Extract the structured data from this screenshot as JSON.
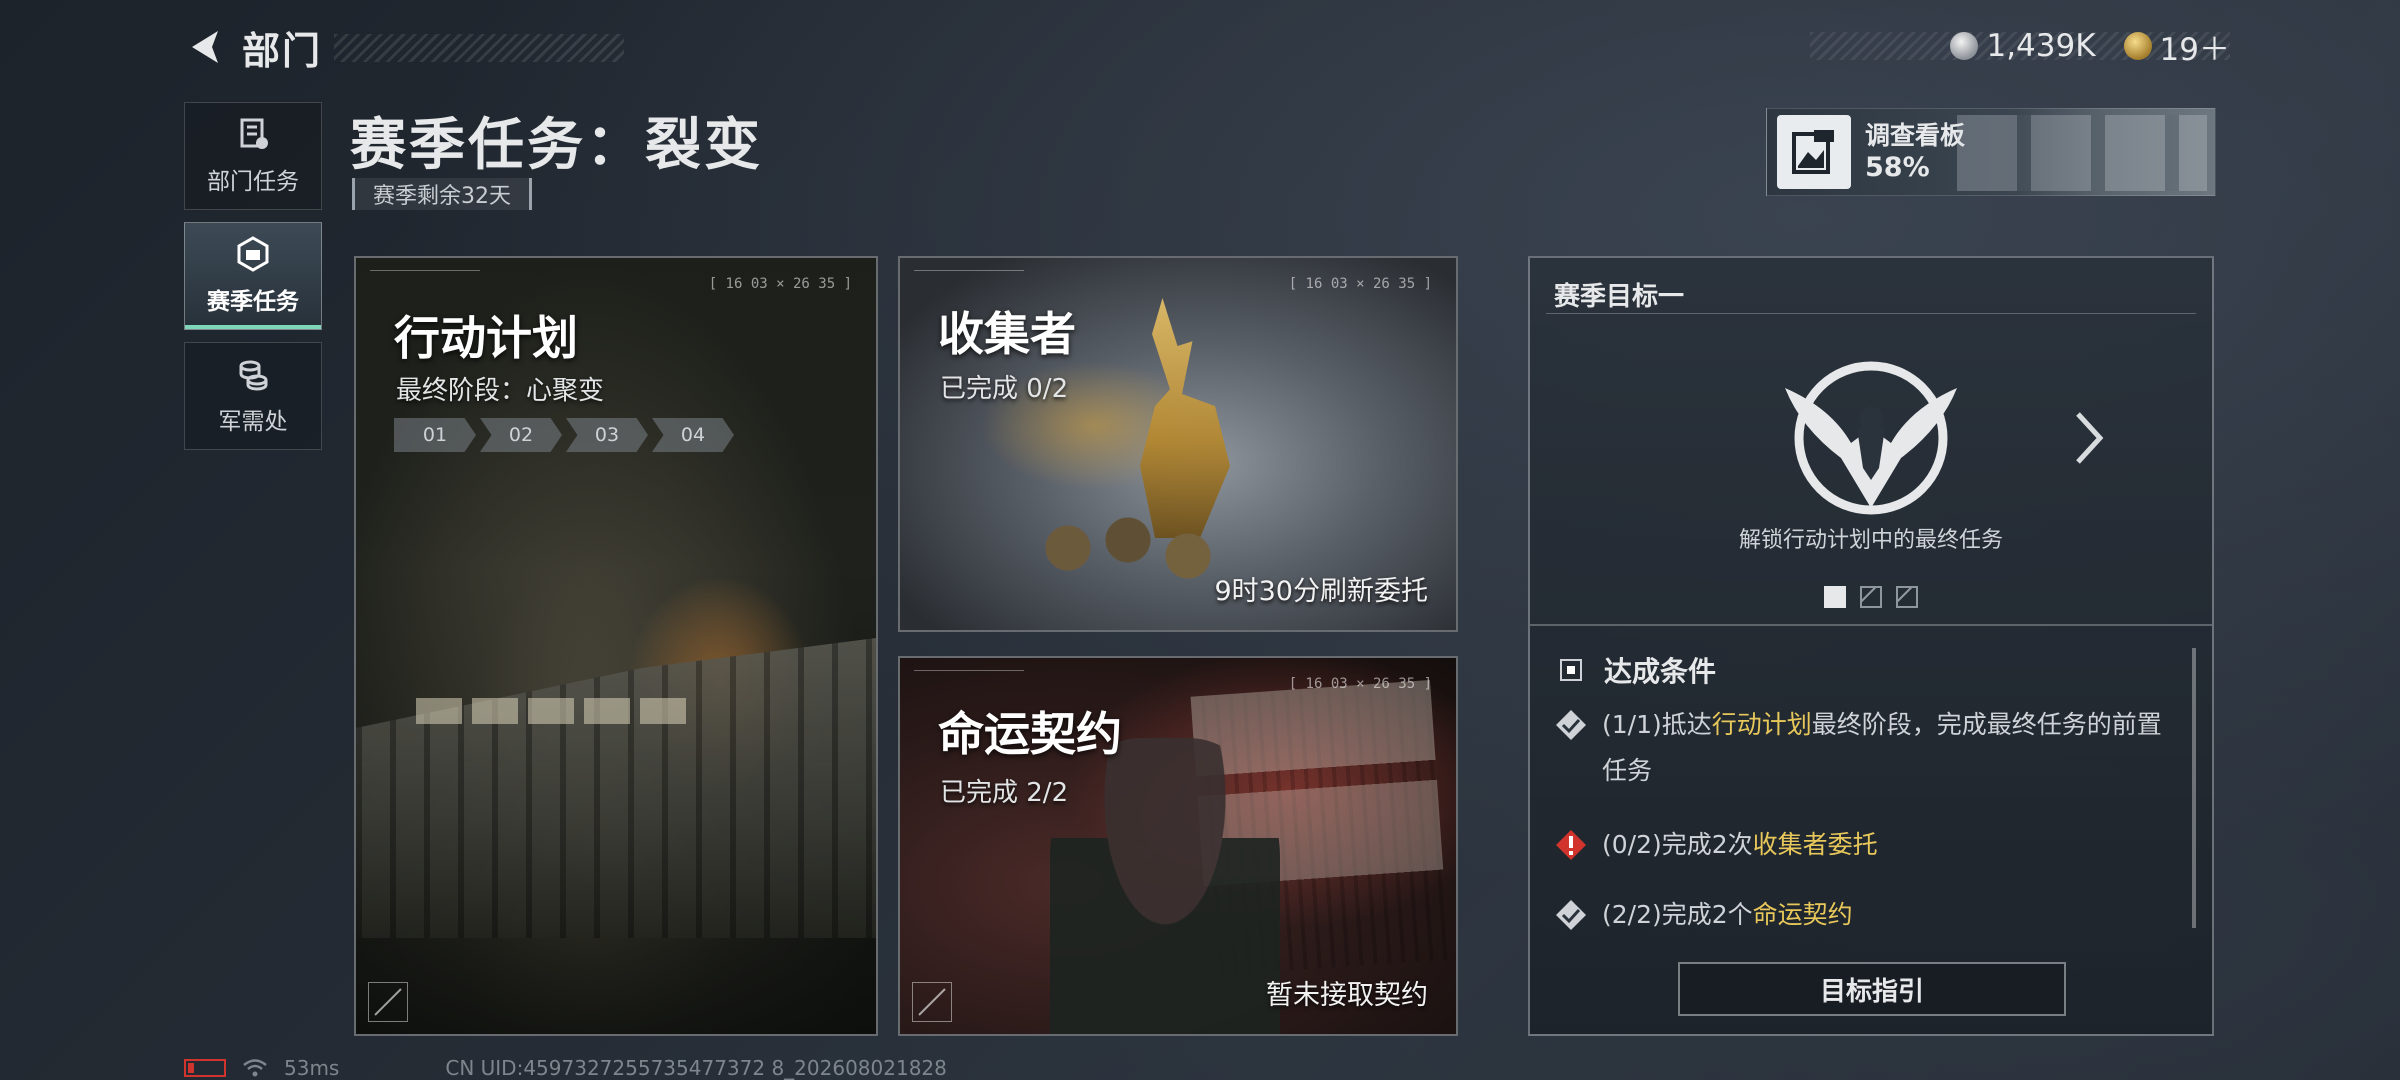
{
  "header": {
    "back_title": "部门",
    "currency": [
      {
        "icon": "silver-coin-icon",
        "value": "1,439K"
      },
      {
        "icon": "gold-coin-icon",
        "value": "19＋"
      }
    ]
  },
  "nav": {
    "items": [
      {
        "label": "部门任务",
        "icon": "department-task-icon",
        "active": false
      },
      {
        "label": "赛季任务",
        "icon": "season-task-icon",
        "active": true
      },
      {
        "label": "军需处",
        "icon": "supply-icon",
        "active": false
      }
    ]
  },
  "page": {
    "title": "赛季任务：裂变",
    "season_remaining": "赛季剩余32天"
  },
  "survey_board": {
    "label": "调查看板",
    "progress": "58%"
  },
  "cards": {
    "plan": {
      "title": "行动计划",
      "subtitle": "最终阶段：心聚变",
      "stages": [
        "01",
        "02",
        "03",
        "04"
      ],
      "hud": "[ 16 03 × 26 35 ]"
    },
    "collector": {
      "title": "收集者",
      "subtitle": "已完成 0/2",
      "footer": "9时30分刷新委托",
      "hud": "[ 16 03 × 26 35 ]"
    },
    "fate": {
      "title": "命运契约",
      "subtitle": "已完成 2/2",
      "footer": "暂未接取契约",
      "hud": "[ 16 03 × 26 35 ]"
    }
  },
  "goal": {
    "title": "赛季目标一",
    "unlock_text": "解锁行动计划中的最终任务",
    "pager": {
      "current": 1,
      "total": 3
    },
    "conditions_title": "达成条件",
    "conditions": [
      {
        "status": "done",
        "pre": "(1/1)抵达",
        "highlight": "行动计划",
        "post": "最终阶段，完成最终任务的前置任务"
      },
      {
        "status": "warn",
        "pre": "(0/2)完成2次",
        "highlight": "收集者委托",
        "post": ""
      },
      {
        "status": "done",
        "pre": "(2/2)完成2个",
        "highlight": "命运契约",
        "post": ""
      }
    ],
    "guide_button": "目标指引"
  },
  "status_bar": {
    "ping": "53ms",
    "uid": "CN UID:4597327255735477372 8_202608021828"
  },
  "colors": {
    "accent_highlight": "#e8c85a",
    "warning_red": "#d0342c",
    "active_tab_line": "#7fd6b8"
  }
}
